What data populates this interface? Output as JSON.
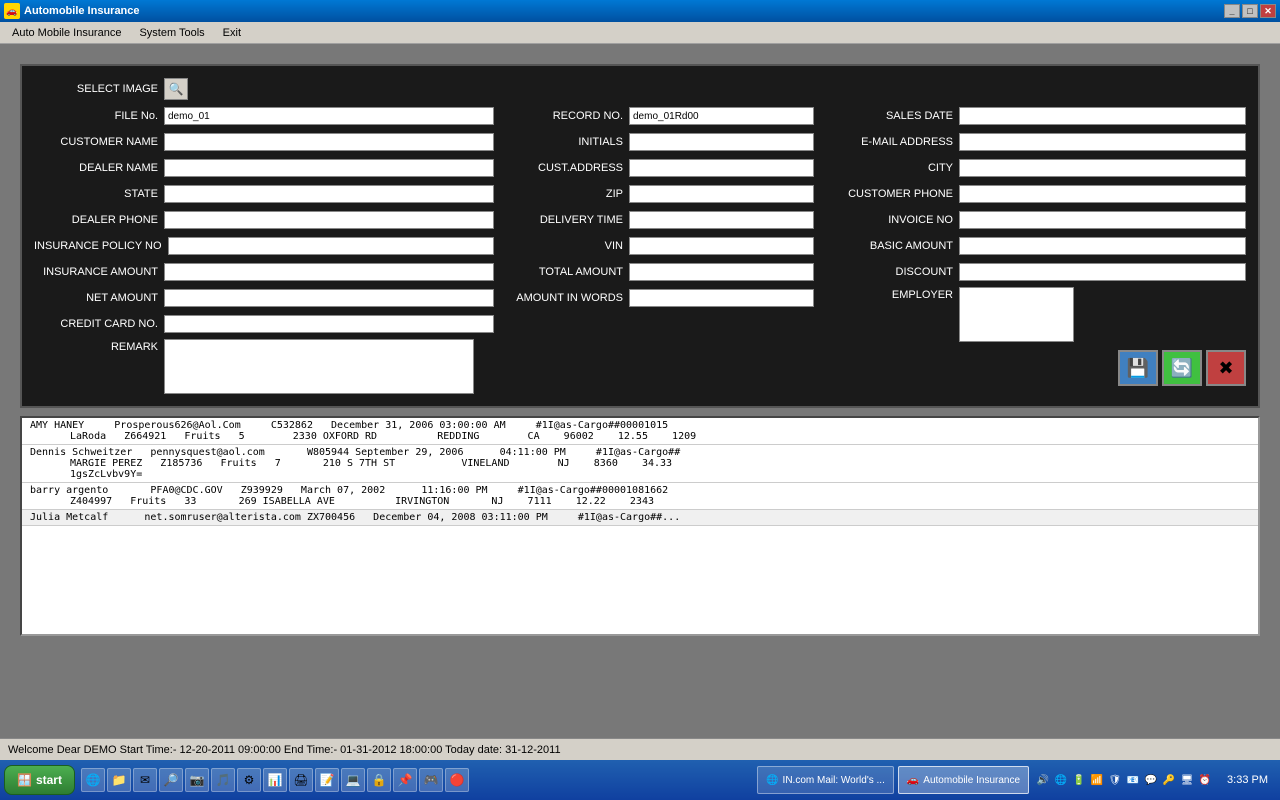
{
  "window": {
    "title": "Automobile Insurance",
    "icon": "🚗"
  },
  "menu": {
    "items": [
      "Auto Mobile Insurance",
      "System Tools",
      "Exit"
    ]
  },
  "form": {
    "select_image_label": "SELECT IMAGE",
    "fields_col1": [
      {
        "label": "FILE No.",
        "value": "demo_01",
        "id": "file-no"
      },
      {
        "label": "CUSTOMER NAME",
        "value": "",
        "id": "customer-name"
      },
      {
        "label": "DEALER NAME",
        "value": "",
        "id": "dealer-name"
      },
      {
        "label": "STATE",
        "value": "",
        "id": "state"
      },
      {
        "label": "DEALER PHONE",
        "value": "",
        "id": "dealer-phone"
      },
      {
        "label": "INSURANCE POLICY NO",
        "value": "",
        "id": "insurance-policy-no"
      },
      {
        "label": "INSURANCE AMOUNT",
        "value": "",
        "id": "insurance-amount"
      },
      {
        "label": "NET AMOUNT",
        "value": "",
        "id": "net-amount"
      },
      {
        "label": "CREDIT CARD NO.",
        "value": "",
        "id": "credit-card-no"
      }
    ],
    "remark_label": "REMARK",
    "fields_col2": [
      {
        "label": "RECORD NO.",
        "value": "demo_01Rd00",
        "id": "record-no"
      },
      {
        "label": "INITIALS",
        "value": "",
        "id": "initials"
      },
      {
        "label": "CUST.ADDRESS",
        "value": "",
        "id": "cust-address"
      },
      {
        "label": "ZIP",
        "value": "",
        "id": "zip"
      },
      {
        "label": "DELIVERY TIME",
        "value": "",
        "id": "delivery-time"
      },
      {
        "label": "VIN",
        "value": "",
        "id": "vin"
      },
      {
        "label": "TOTAL AMOUNT",
        "value": "",
        "id": "total-amount"
      },
      {
        "label": "AMOUNT IN WORDS",
        "value": "",
        "id": "amount-in-words"
      }
    ],
    "fields_col3": [
      {
        "label": "SALES DATE",
        "value": "",
        "id": "sales-date"
      },
      {
        "label": "E-MAIL ADDRESS",
        "value": "",
        "id": "email-address"
      },
      {
        "label": "CITY",
        "value": "",
        "id": "city"
      },
      {
        "label": "CUSTOMER PHONE",
        "value": "",
        "id": "customer-phone"
      },
      {
        "label": "INVOICE NO",
        "value": "",
        "id": "invoice-no"
      },
      {
        "label": "BASIC AMOUNT",
        "value": "",
        "id": "basic-amount"
      },
      {
        "label": "DISCOUNT",
        "value": "",
        "id": "discount"
      }
    ],
    "employer_label": "EMPLOYER",
    "buttons": {
      "save": "💾",
      "refresh": "🔄",
      "close": "✖"
    }
  },
  "grid": {
    "rows": [
      {
        "line1": "AMY HANEY    Prosperous626@Aol.Com    C532862  December 31, 2006 03:00:00 AM    #1I@as-Cargo##00001015",
        "line2": "LaRoda   Z664921  Fruits   5      2330 OXFORD RD          REDDING        CA    96002    12.55    1209"
      },
      {
        "line1": "Dennis Schweitzer  pennysquest@aol.com      W805944 September 29, 2006     04:11:00 PM    #1I@as-Cargo##",
        "line2": "MARGIE PEREZ  Z185736  Fruits   7      210 S 7TH ST          VINELAND       NJ    8360    34.33",
        "line3": "1gsZcLvbv9Y="
      },
      {
        "line1": "barry argento      PFA0@CDC.GOV  Z939929  March 07, 2002     11:16:00 PM    #1I@as-Cargo##00001081662",
        "line2": "Z404997  Fruits  33      269 ISABELLA AVE         IRVINGTON       NJ    7111    12.22    2343"
      },
      {
        "line1": "Julia Metcalf      net.somruser@alterista.com ZX700456   December 04, 2008 03:11:00 PM    #1I@as-Cargo##..."
      }
    ]
  },
  "status_bar": {
    "text": "Welcome Dear DEMO  Start Time:- 12-20-2011 09:00:00  End Time:- 01-31-2012 18:00:00  Today date: 31-12-2011"
  },
  "taskbar": {
    "start_label": "start",
    "apps": [
      {
        "label": "IN.com Mail: World's ...",
        "active": false,
        "icon": "🌐"
      },
      {
        "label": "Automobile Insurance",
        "active": true,
        "icon": "🚗"
      }
    ],
    "clock": "3:33 PM",
    "tray_icons": [
      "🔊",
      "🌐",
      "🔒",
      "⚡",
      "📶"
    ]
  }
}
